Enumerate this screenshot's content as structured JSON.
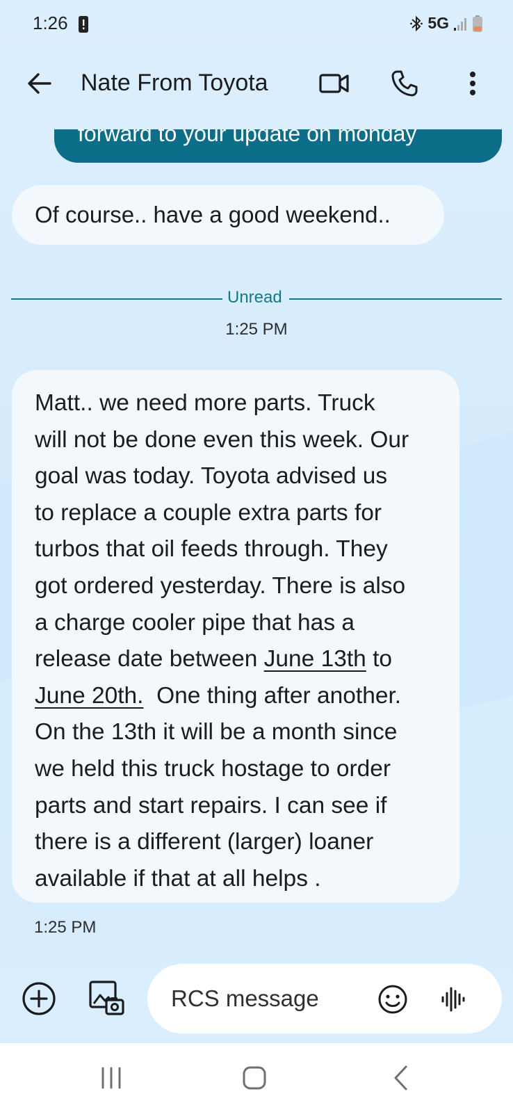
{
  "status_bar": {
    "time": "1:26",
    "network": "5G"
  },
  "header": {
    "contact_name": "Nate From Toyota",
    "icons": [
      "arrow-left-icon",
      "video-call-icon",
      "phone-icon",
      "more-vert-icon"
    ]
  },
  "conversation": {
    "sent_fragment": "forward to your update on monday",
    "reply_short": "Of course.. have a good weekend..",
    "unread_label": "Unread",
    "unread_time": "1:25 PM",
    "long_message_lines": [
      "Matt.. we need more parts. Truck",
      "will not be done even this week. Our",
      "goal was today.  Toyota advised us",
      "to replace a couple extra parts for",
      "turbos that oil feeds through. They",
      "got ordered yesterday. There is also",
      "a charge cooler pipe that has a"
    ],
    "line8_prefix": "release date between ",
    "date_link_1": "June 13th",
    "line8_suffix": " to",
    "date_link_2": "June 20th.",
    "line9_suffix": "  One thing after another.",
    "long_message_tail": [
      "On the 13th it will be a month since",
      "we held this truck hostage to order",
      "parts and start repairs.  I can see if",
      "there is a different (larger) loaner",
      "available if that at all helps ."
    ],
    "message_time": "1:25 PM"
  },
  "compose": {
    "placeholder": "RCS message",
    "value": "",
    "icons": [
      "add-icon",
      "gallery-icon",
      "emoji-icon",
      "voice-icon"
    ]
  },
  "colors": {
    "sent_bubble": "#0d6e8a",
    "received_bubble": "#f3f8fd",
    "unread_accent": "#137a86",
    "background": "#d7ecfc"
  }
}
